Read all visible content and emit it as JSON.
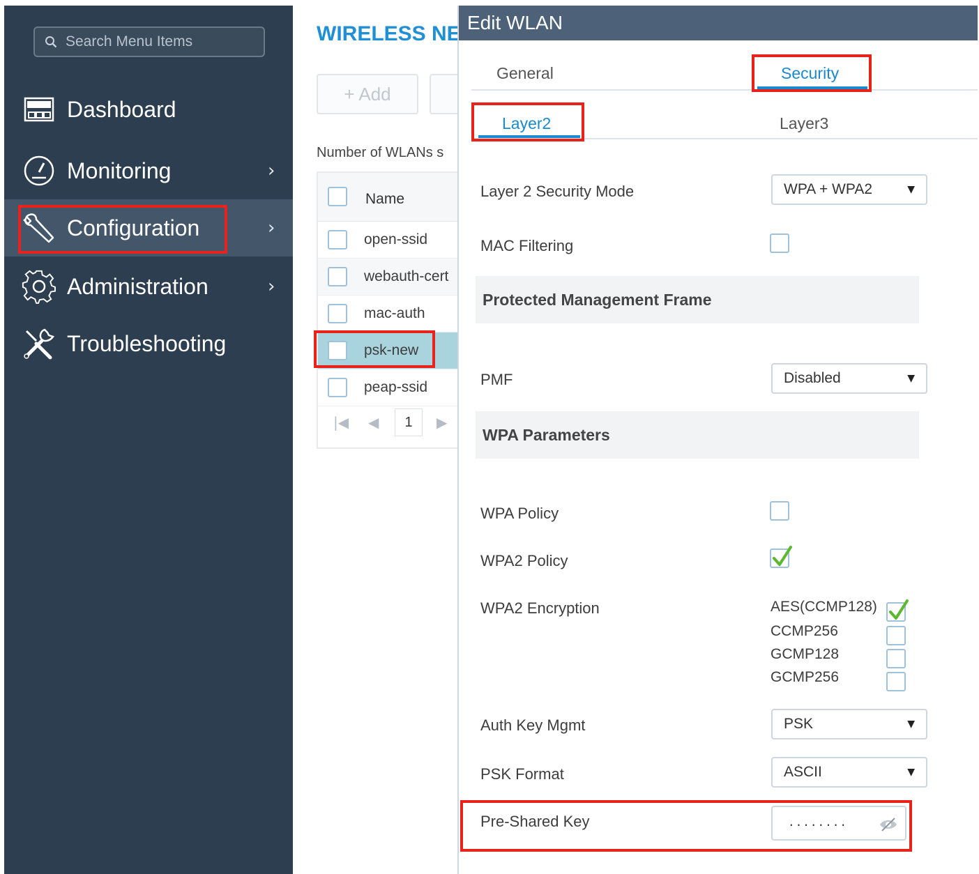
{
  "sidebar": {
    "search_placeholder": "Search Menu Items",
    "items": [
      {
        "label": "Dashboard",
        "icon": "dashboard-icon",
        "has_chevron": false
      },
      {
        "label": "Monitoring",
        "icon": "gauge-icon",
        "has_chevron": true
      },
      {
        "label": "Configuration",
        "icon": "wrench-icon",
        "has_chevron": true,
        "active": true
      },
      {
        "label": "Administration",
        "icon": "gear-icon",
        "has_chevron": true
      },
      {
        "label": "Troubleshooting",
        "icon": "tools-icon",
        "has_chevron": false
      }
    ],
    "chevron": "›"
  },
  "main": {
    "title": "WIRELESS NET",
    "add_button": "+ Add",
    "wlan_count_label": "Number of WLANs s",
    "table": {
      "header": "Name",
      "rows": [
        "open-ssid",
        "webauth-cert",
        "mac-auth",
        "psk-new",
        "peap-ssid"
      ],
      "selected_row": "psk-new"
    },
    "pager": {
      "first": "|◀",
      "prev": "◀",
      "page": "1",
      "next": "▶"
    }
  },
  "edit_wlan": {
    "title": "Edit WLAN",
    "tabs": [
      {
        "label": "General"
      },
      {
        "label": "Security",
        "active": true
      }
    ],
    "subtabs": [
      {
        "label": "Layer2",
        "active": true
      },
      {
        "label": "Layer3"
      }
    ],
    "layer2_security_mode": {
      "label": "Layer 2 Security Mode",
      "value": "WPA + WPA2"
    },
    "mac_filtering": {
      "label": "MAC Filtering",
      "checked": false
    },
    "pmf_section": "Protected Management Frame",
    "pmf": {
      "label": "PMF",
      "value": "Disabled"
    },
    "wpa_section": "WPA Parameters",
    "wpa_policy": {
      "label": "WPA Policy",
      "checked": false
    },
    "wpa2_policy": {
      "label": "WPA2 Policy",
      "checked": true
    },
    "wpa2_encryption": {
      "label": "WPA2 Encryption",
      "options": [
        {
          "label": "AES(CCMP128)",
          "checked": true
        },
        {
          "label": "CCMP256",
          "checked": false
        },
        {
          "label": "GCMP128",
          "checked": false
        },
        {
          "label": "GCMP256",
          "checked": false
        }
      ]
    },
    "auth_key_mgmt": {
      "label": "Auth Key Mgmt",
      "value": "PSK"
    },
    "psk_format": {
      "label": "PSK Format",
      "value": "ASCII"
    },
    "pre_shared_key": {
      "label": "Pre-Shared Key",
      "value": "........"
    },
    "caret": "▼"
  },
  "colors": {
    "sidebar_bg": "#2c3e50",
    "header_bg": "#4d6278",
    "accent_blue": "#1a8ad0",
    "highlight_red": "#e8231b",
    "check_green": "#5cb82e"
  }
}
